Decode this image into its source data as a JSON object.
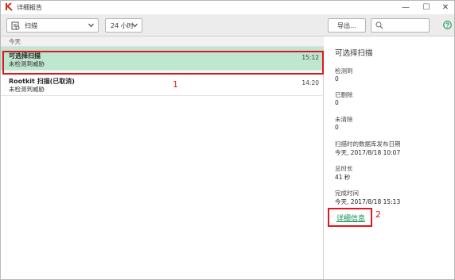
{
  "window": {
    "title": "详细报告",
    "controls": {
      "minimize": "—",
      "maximize": "☐",
      "close": "✕"
    }
  },
  "toolbar": {
    "scan_filter": {
      "value": "扫描",
      "icon": "scan-report-icon"
    },
    "time_filter": {
      "value": "24 小时"
    },
    "export_label": "导出...",
    "search": {
      "placeholder": "",
      "icon": "search-icon"
    },
    "help_icon": "help-icon"
  },
  "list": {
    "group_header": "今天",
    "items": [
      {
        "title": "可选择扫描",
        "subtitle": "未检测到威胁",
        "time": "15:12",
        "selected": true
      },
      {
        "title": "Rootkit 扫描(已取消)",
        "subtitle": "未检测到威胁",
        "time": "14:20",
        "selected": false
      }
    ]
  },
  "details": {
    "title": "可选择扫描",
    "fields": [
      {
        "label": "检测到",
        "value": "0"
      },
      {
        "label": "已删除",
        "value": "0"
      },
      {
        "label": "未清除",
        "value": "0"
      },
      {
        "label": "扫描时的数据库发布日期",
        "value": "今天, 2017/8/18 10:07"
      },
      {
        "label": "总时长",
        "value": "41 秒"
      },
      {
        "label": "完成时间",
        "value": "今天, 2017/8/18 15:13"
      }
    ],
    "more_link": "详细信息"
  },
  "annotations": [
    {
      "number": "1"
    },
    {
      "number": "2"
    }
  ],
  "colors": {
    "selected_row": "#bfe6cf",
    "link_green": "#0a8f4a",
    "annotation_red": "#e0161d",
    "brand_red": "#d52b1e"
  }
}
